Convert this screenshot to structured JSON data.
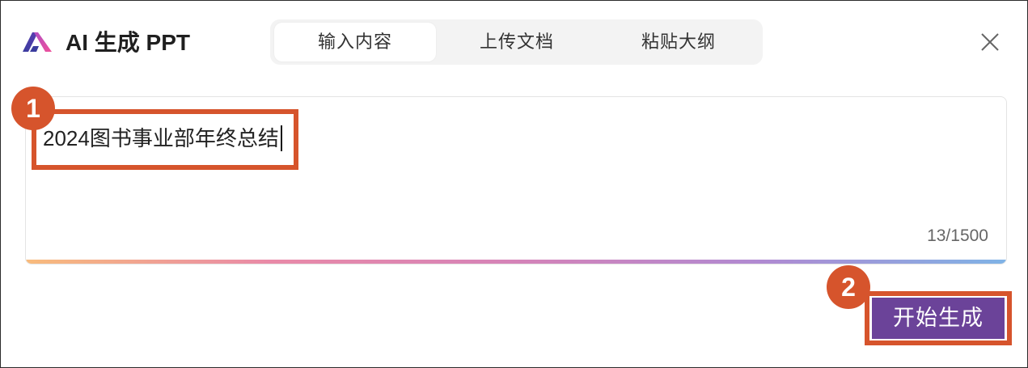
{
  "header": {
    "logo_icon": "ai-ppt-logo-icon",
    "title": "AI 生成 PPT",
    "close_icon": "close-icon"
  },
  "tabs": [
    {
      "label": "输入内容",
      "active": true
    },
    {
      "label": "上传文档",
      "active": false
    },
    {
      "label": "粘贴大纲",
      "active": false
    }
  ],
  "editor": {
    "value": "2024图书事业部年终总结",
    "char_count": "13/1500"
  },
  "annotations": {
    "step1": "1",
    "step2": "2"
  },
  "actions": {
    "generate_label": "开始生成"
  },
  "colors": {
    "accent": "#6b4399",
    "annotation": "#d6542c",
    "input_underline_gradient": [
      "#f8bb7c",
      "#e98aa8",
      "#d583b8",
      "#b08ad2",
      "#7fb3e6"
    ]
  }
}
